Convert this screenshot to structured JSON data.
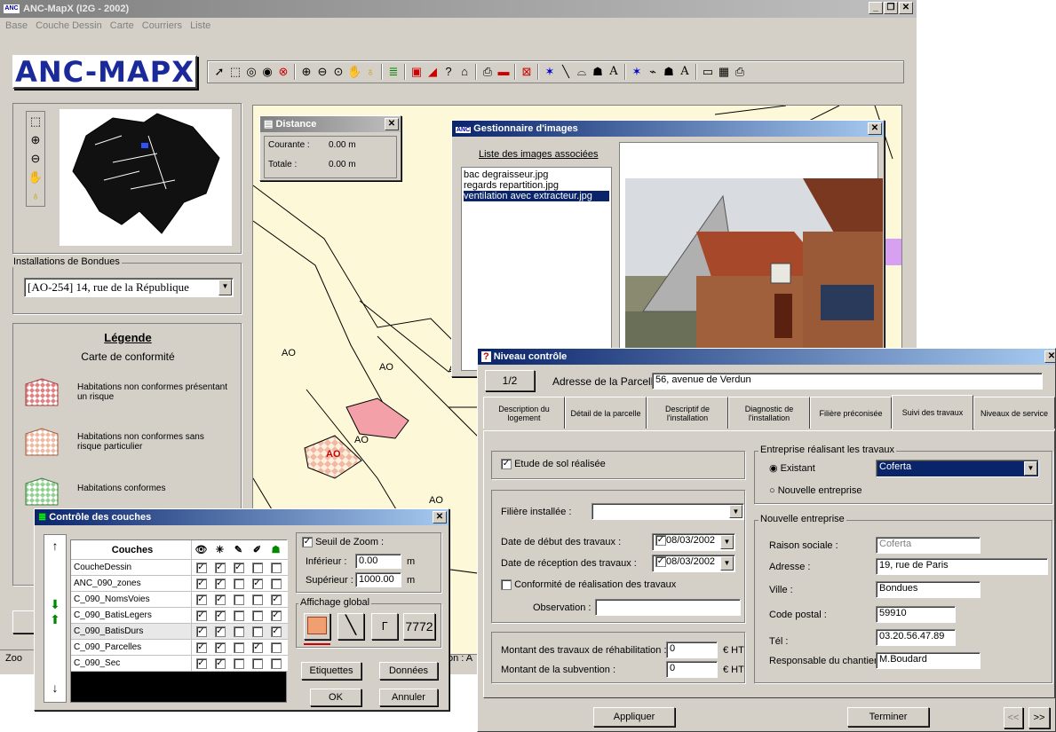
{
  "main": {
    "title": "ANC-MapX  (I2G - 2002)",
    "menu": [
      "Base",
      "Couche Dessin",
      "Carte",
      "Courriers",
      "Liste"
    ],
    "logo": "ANC-MAPX",
    "status": "Zoo",
    "status_right": "on : A"
  },
  "installations": {
    "label": "Installations de Bondues",
    "value": "[AO-254] 14, rue de la République"
  },
  "legend": {
    "title": "Légende",
    "subtitle": "Carte de conformité",
    "items": [
      {
        "label": "Habitations non conformes présentant un risque",
        "color": "#e08080"
      },
      {
        "label": "Habitations non conformes sans risque particulier",
        "color": "#f0b8a0"
      },
      {
        "label": "Habitations conformes",
        "color": "#90d090"
      }
    ]
  },
  "map": {
    "labels": [
      "AO",
      "AO",
      "AO",
      "AO",
      "AO",
      "A"
    ]
  },
  "distance": {
    "title": "Distance",
    "courante_label": "Courante :",
    "courante_value": "0.00 m",
    "totale_label": "Totale :",
    "totale_value": "0.00 m"
  },
  "images": {
    "title": "Gestionnaire d'images",
    "list_label": "Liste des images associées",
    "items": [
      "bac degraisseur.jpg",
      "regards repartition.jpg",
      "ventilation avec extracteur.jpg"
    ],
    "selected_index": 2
  },
  "layers": {
    "title": "Contrôle des couches",
    "header": "Couches",
    "rows": [
      {
        "name": "CoucheDessin",
        "c": [
          1,
          1,
          1,
          0,
          0
        ]
      },
      {
        "name": "ANC_090_zones",
        "c": [
          1,
          1,
          0,
          1,
          0
        ]
      },
      {
        "name": "C_090_NomsVoies",
        "c": [
          1,
          1,
          0,
          0,
          1
        ]
      },
      {
        "name": "C_090_BatisLegers",
        "c": [
          1,
          1,
          0,
          0,
          1
        ]
      },
      {
        "name": "C_090_BatisDurs",
        "c": [
          1,
          1,
          0,
          0,
          1
        ]
      },
      {
        "name": "C_090_Parcelles",
        "c": [
          1,
          1,
          0,
          1,
          0
        ]
      },
      {
        "name": "C_090_Sec",
        "c": [
          1,
          1,
          0,
          0,
          0
        ]
      }
    ],
    "seuil_label": "Seuil de Zoom :",
    "inferieur_label": "Inférieur :",
    "inferieur_value": "0.00",
    "superieur_label": "Supérieur :",
    "superieur_value": "1000.00",
    "unit": "m",
    "affichage_label": "Affichage global",
    "sample_text": "7772",
    "etiquettes": "Etiquettes",
    "donnees": "Données",
    "ok": "OK",
    "annuler": "Annuler"
  },
  "niveau": {
    "title": "Niveau contrôle",
    "page": "1/2",
    "adresse_label": "Adresse de la Parcelle :",
    "adresse_value": "56, avenue de Verdun",
    "tabs": [
      "Description du logement",
      "Détail de la parcelle",
      "Descriptif de l'installation",
      "Diagnostic de l'installation",
      "Filière préconisée",
      "Suivi des travaux",
      "Niveaux de service"
    ],
    "active_tab": 5,
    "etude": "Etude de sol réalisée",
    "filiere_label": "Filière installée :",
    "date_debut_label": "Date de début des travaux :",
    "date_debut_value": "08/03/2002",
    "date_reception_label": "Date de réception des travaux :",
    "date_reception_value": "08/03/2002",
    "conformite": "Conformité de réalisation des travaux",
    "observation_label": "Observation :",
    "montant_label": "Montant des travaux de réhabilitation :",
    "montant_value": "0",
    "subvention_label": "Montant de la subvention :",
    "subvention_value": "0",
    "currency": "€ HT",
    "entreprise_group": "Entreprise réalisant les travaux",
    "existant": "Existant",
    "existant_value": "Coferta",
    "nouvelle": "Nouvelle entreprise",
    "nouvelle_group": "Nouvelle entreprise",
    "raison_label": "Raison sociale :",
    "raison_value": "Coferta",
    "adresse2_label": "Adresse :",
    "adresse2_value": "19, rue de Paris",
    "ville_label": "Ville :",
    "ville_value": "Bondues",
    "cp_label": "Code postal :",
    "cp_value": "59910",
    "tel_label": "Tél :",
    "tel_value": "03.20.56.47.89",
    "resp_label": "Responsable du chantier :",
    "resp_value": "M.Boudard",
    "appliquer": "Appliquer",
    "terminer": "Terminer",
    "prev": "<<",
    "next": ">>"
  }
}
